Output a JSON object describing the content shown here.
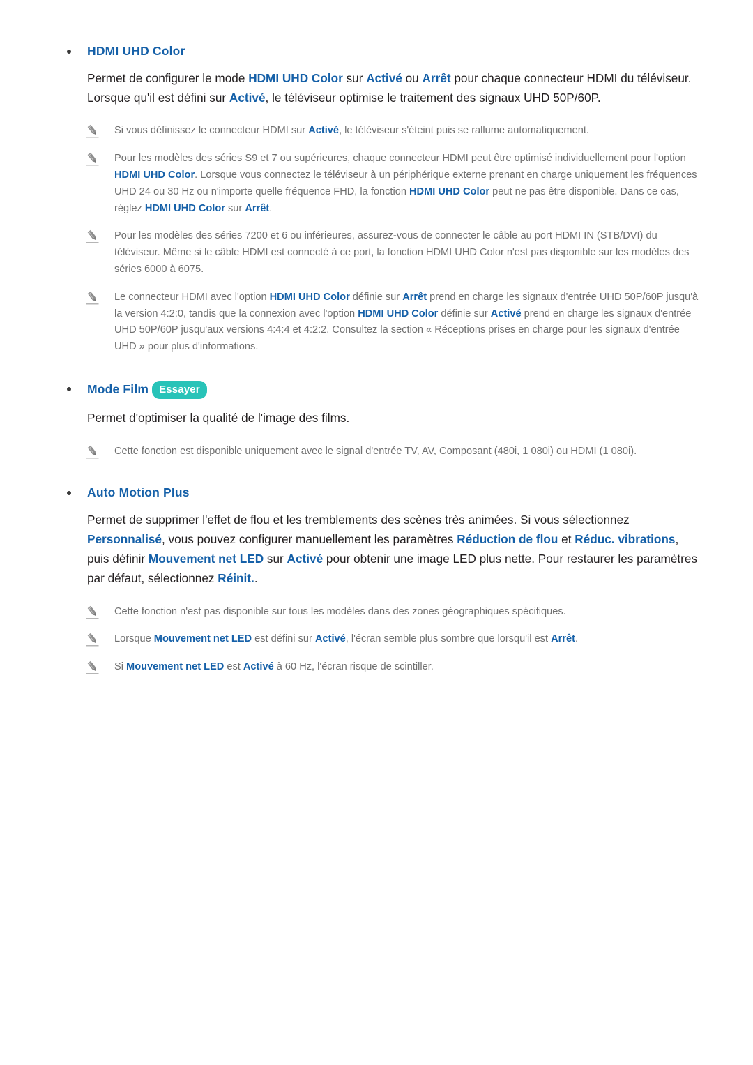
{
  "colors": {
    "heading_blue": "#1560a8",
    "body_text": "#231f20",
    "note_text": "#6f6f6f",
    "badge_teal": "#28c3b8",
    "bullet_dot": "#3a3a3a",
    "page_background": "#ffffff"
  },
  "icons": {
    "note": "pencil-icon",
    "bullet": "bullet-dot-icon",
    "badge": "try-badge"
  },
  "sections": [
    {
      "id": "hdmi-uhd-color",
      "heading": "HDMI UHD Color",
      "badge": null,
      "body_parts": [
        {
          "t": "Permet de configurer le mode ",
          "b": false
        },
        {
          "t": "HDMI UHD Color",
          "b": true
        },
        {
          "t": " sur ",
          "b": false
        },
        {
          "t": "Activé",
          "b": true
        },
        {
          "t": " ou ",
          "b": false
        },
        {
          "t": "Arrêt",
          "b": true
        },
        {
          "t": " pour chaque connecteur HDMI du téléviseur. Lorsque qu'il est défini sur ",
          "b": false
        },
        {
          "t": "Activé",
          "b": true
        },
        {
          "t": ", le téléviseur optimise le traitement des signaux UHD 50P/60P.",
          "b": false
        }
      ],
      "notes": [
        [
          {
            "t": "Si vous définissez le connecteur HDMI sur ",
            "b": false
          },
          {
            "t": "Activé",
            "b": true
          },
          {
            "t": ", le téléviseur s'éteint puis se rallume automatiquement.",
            "b": false
          }
        ],
        [
          {
            "t": "Pour les modèles des séries S9 et 7  ou supérieures, chaque connecteur HDMI peut être optimisé individuellement pour l'option ",
            "b": false
          },
          {
            "t": "HDMI UHD Color",
            "b": true
          },
          {
            "t": ". Lorsque vous connectez le téléviseur à un périphérique externe prenant en charge uniquement les fréquences UHD 24 ou 30 Hz ou n'importe quelle fréquence FHD, la fonction ",
            "b": false
          },
          {
            "t": "HDMI UHD Color",
            "b": true
          },
          {
            "t": " peut ne pas être disponible. Dans ce cas, réglez ",
            "b": false
          },
          {
            "t": "HDMI UHD Color",
            "b": true
          },
          {
            "t": " sur ",
            "b": false
          },
          {
            "t": "Arrêt",
            "b": true
          },
          {
            "t": ".",
            "b": false
          }
        ],
        [
          {
            "t": "Pour les modèles des séries 7200 et 6 ou inférieures, assurez-vous de connecter le câble au port HDMI IN (STB/DVI) du téléviseur. Même si le câble HDMI est connecté à ce port, la fonction HDMI UHD Color n'est pas disponible sur les modèles des séries 6000 à 6075.",
            "b": false
          }
        ],
        [
          {
            "t": "Le connecteur HDMI avec l'option ",
            "b": false
          },
          {
            "t": "HDMI UHD Color",
            "b": true
          },
          {
            "t": " définie sur ",
            "b": false
          },
          {
            "t": "Arrêt",
            "b": true
          },
          {
            "t": " prend en charge les signaux d'entrée UHD 50P/60P jusqu'à la version 4:2:0, tandis que la connexion avec l'option ",
            "b": false
          },
          {
            "t": "HDMI UHD Color",
            "b": true
          },
          {
            "t": " définie sur ",
            "b": false
          },
          {
            "t": "Activé",
            "b": true
          },
          {
            "t": " prend en charge les signaux d'entrée UHD 50P/60P jusqu'aux versions 4:4:4 et 4:2:2. Consultez la section « Réceptions prises en charge pour les signaux d'entrée UHD » pour plus d'informations.",
            "b": false
          }
        ]
      ]
    },
    {
      "id": "mode-film",
      "heading": "Mode Film",
      "badge": "Essayer",
      "body_parts": [
        {
          "t": "Permet d'optimiser la qualité de l'image des films.",
          "b": false
        }
      ],
      "notes": [
        [
          {
            "t": "Cette fonction est disponible uniquement avec le signal d'entrée TV, AV, Composant (480i, 1 080i) ou HDMI (1 080i).",
            "b": false
          }
        ]
      ]
    },
    {
      "id": "auto-motion-plus",
      "heading": "Auto Motion Plus",
      "badge": null,
      "body_parts": [
        {
          "t": "Permet de supprimer l'effet de flou et les tremblements des scènes très animées. Si vous sélectionnez ",
          "b": false
        },
        {
          "t": "Personnalisé",
          "b": true
        },
        {
          "t": ", vous pouvez configurer manuellement les paramètres ",
          "b": false
        },
        {
          "t": "Réduction de flou",
          "b": true
        },
        {
          "t": " et ",
          "b": false
        },
        {
          "t": "Réduc. vibrations",
          "b": true
        },
        {
          "t": ", puis définir ",
          "b": false
        },
        {
          "t": "Mouvement net LED",
          "b": true
        },
        {
          "t": " sur ",
          "b": false
        },
        {
          "t": "Activé",
          "b": true
        },
        {
          "t": " pour obtenir une image LED plus nette. Pour restaurer les paramètres par défaut, sélectionnez ",
          "b": false
        },
        {
          "t": "Réinit.",
          "b": true
        },
        {
          "t": ".",
          "b": false
        }
      ],
      "notes": [
        [
          {
            "t": "Cette fonction n'est pas disponible sur tous les modèles dans des zones géographiques spécifiques.",
            "b": false
          }
        ],
        [
          {
            "t": "Lorsque ",
            "b": false
          },
          {
            "t": "Mouvement net LED",
            "b": true
          },
          {
            "t": " est défini sur ",
            "b": false
          },
          {
            "t": "Activé",
            "b": true
          },
          {
            "t": ", l'écran semble plus sombre que lorsqu'il est ",
            "b": false
          },
          {
            "t": "Arrêt",
            "b": true
          },
          {
            "t": ".",
            "b": false
          }
        ],
        [
          {
            "t": "Si ",
            "b": false
          },
          {
            "t": "Mouvement net LED",
            "b": true
          },
          {
            "t": " est ",
            "b": false
          },
          {
            "t": "Activé",
            "b": true
          },
          {
            "t": " à 60 Hz, l'écran risque de scintiller.",
            "b": false
          }
        ]
      ]
    }
  ]
}
